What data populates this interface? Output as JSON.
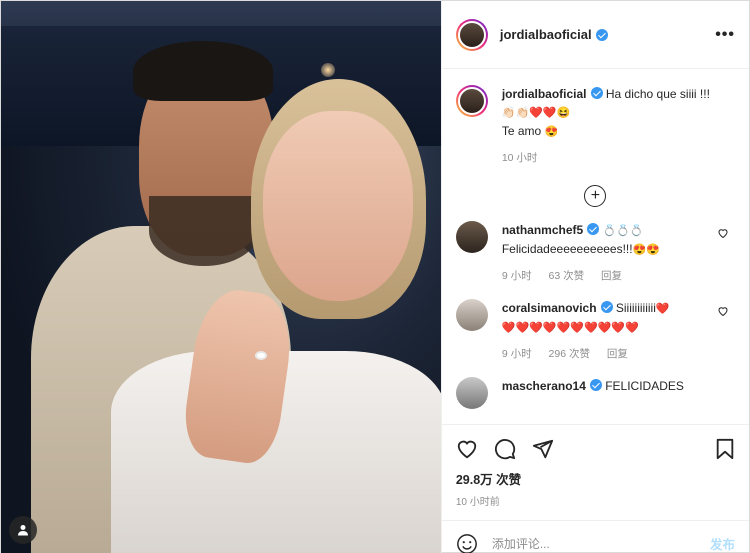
{
  "author": {
    "username": "jordialbaoficial",
    "more_label": "•••"
  },
  "caption": {
    "username": "jordialbaoficial",
    "text": "Ha dicho que siiii !!!",
    "emojis": "👏🏻👏🏻❤️❤️😆",
    "line2": "Te amo",
    "line2_emoji": "😍",
    "time": "10 小时"
  },
  "load_more_label": "+",
  "comments": [
    {
      "username": "nathanmchef5",
      "badges": "💍💍💍",
      "text": "Felicidadeeeeeeeeees!!!",
      "emojis": "😍😍",
      "time": "9 小时",
      "likes": "63 次赞",
      "reply": "回复"
    },
    {
      "username": "coralsimanovich",
      "text": "Siiiiiiiiiiii",
      "emojis": "❤️",
      "hearts_line": "❤️❤️❤️❤️❤️❤️❤️❤️❤️❤️",
      "time": "9 小时",
      "likes": "296 次赞",
      "reply": "回复"
    },
    {
      "username": "mascherano14",
      "text": "FELICIDADES"
    }
  ],
  "stats": {
    "likes": "29.8万 次赞",
    "time": "10 小时前"
  },
  "composer": {
    "placeholder": "添加评论...",
    "post_label": "发布"
  },
  "colors": {
    "verified": "#3897f0",
    "post_button": "#b2dffc",
    "border": "#dbdbdb"
  }
}
